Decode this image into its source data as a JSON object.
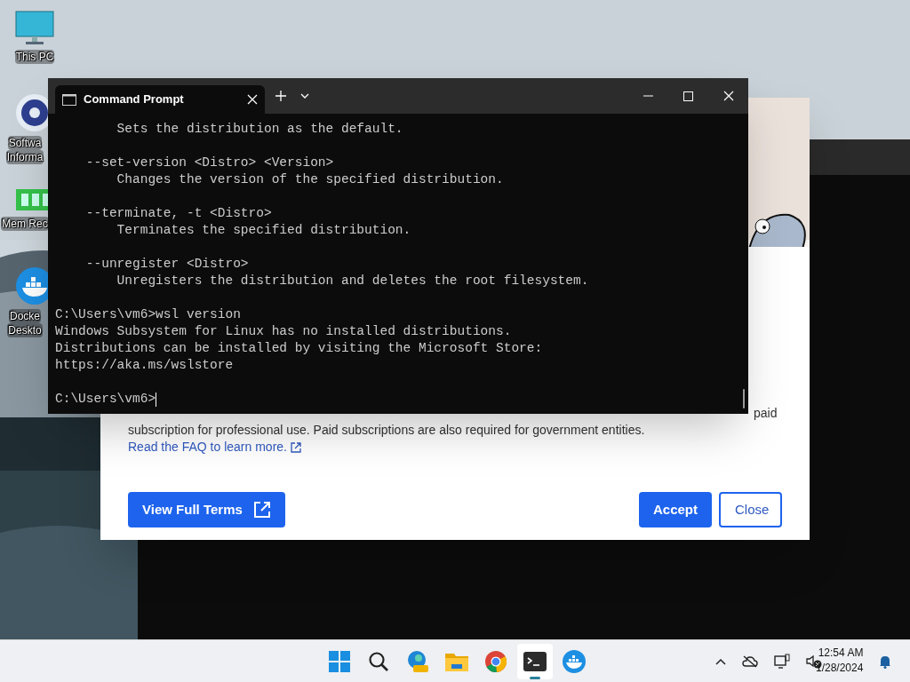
{
  "desktop_icons": [
    {
      "kind": "pc",
      "label": [
        "This PC"
      ]
    },
    {
      "kind": "disc",
      "label": [
        "Softwa",
        "Informa"
      ]
    },
    {
      "kind": "ram",
      "label": [
        "Mem Rec"
      ]
    },
    {
      "kind": "whale",
      "label": [
        "Docke",
        "Deskto"
      ]
    }
  ],
  "dialog": {
    "kind": "picture",
    "text_end": "paid",
    "text": "subscription for professional use. Paid subscriptions are also required for government entities.",
    "link": "Read the FAQ to learn more.",
    "buttons": [
      {
        "label": "View Full Terms",
        "kind": "primary-external"
      },
      {
        "label": "Accept",
        "kind": "primary"
      },
      {
        "label": "Close",
        "kind": "outline"
      }
    ]
  },
  "terminal": {
    "tab": "Command Prompt",
    "blocks": [
      [
        "        Sets the distribution as the default."
      ],
      [
        "    --set-version <Distro> <Version>",
        "        Changes the version of the specified distribution."
      ],
      [
        "    --terminate, -t <Distro>",
        "        Terminates the specified distribution."
      ],
      [
        "    --unregister <Distro>",
        "        Unregisters the distribution and deletes the root filesystem."
      ],
      [
        "C:\\Users\\vm6>wsl version",
        "Windows Subsystem for Linux has no installed distributions.",
        "Distributions can be installed by visiting the Microsoft Store:",
        "https://aka.ms/wslstore"
      ],
      [
        "C:\\Users\\vm6>"
      ]
    ]
  },
  "taskbar": {
    "apps": [
      {
        "kind": "start",
        "active": false
      },
      {
        "kind": "search",
        "active": false
      },
      {
        "kind": "edge",
        "active": false
      },
      {
        "kind": "folder",
        "active": false
      },
      {
        "kind": "chrome",
        "active": false
      },
      {
        "kind": "terminal",
        "active": true
      },
      {
        "kind": "docker",
        "active": false
      }
    ],
    "time": "12:54 AM",
    "date": "1/28/2024"
  }
}
